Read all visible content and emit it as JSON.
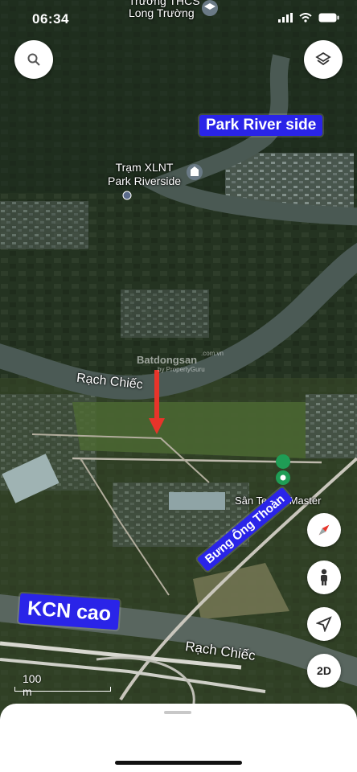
{
  "status_bar": {
    "time": "06:34"
  },
  "map": {
    "top_labels": {
      "line1": "Trường THCS",
      "line2": "Long Trường"
    },
    "poi_xlnt": {
      "line1": "Trạm XLNT",
      "line2": "Park Riverside"
    },
    "river_label_1": "Rạch Chiếc",
    "river_label_2": "Rạch Chiếc",
    "tennis": "Sân Tennis Master",
    "watermark": {
      "brand": "Batdongsan",
      "sub": "by PropertyGuru",
      "tld": ".com.vn"
    },
    "scale": "100 m"
  },
  "annotations": {
    "park_river": "Park River side",
    "bung_ong_thoan": "Bưng Ông Thoàn",
    "kcn": "KCN cao"
  },
  "controls": {
    "search_icon": "search-icon",
    "layers_icon": "layers-icon",
    "compass_icon": "compass-icon",
    "pegman_icon": "person-icon",
    "locate_icon": "location-arrow-icon",
    "mode_label": "2D"
  },
  "colors": {
    "annotation_bg": "#2a24e8",
    "arrow": "#e8342a",
    "river": "#4b5a55"
  }
}
